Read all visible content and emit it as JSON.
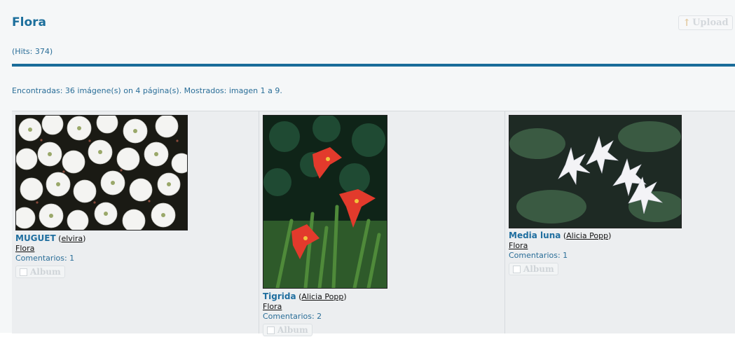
{
  "header": {
    "title": "Flora",
    "hits": "(Hits: 374)",
    "upload_label": "Upload"
  },
  "summary": "Encontradas: 36 imágene(s) on 4 página(s). Mostrados: imagen 1 a 9.",
  "images": [
    {
      "name": "MUGUET",
      "author": "elvira",
      "category": "Flora",
      "comments": "Comentarios: 1",
      "album_label": "Album",
      "subject": "white-flower-cluster"
    },
    {
      "name": "Tigrida",
      "author": "Alicia Popp",
      "category": "Flora",
      "comments": "Comentarios: 2",
      "album_label": "Album",
      "subject": "red-tigridia-flowers"
    },
    {
      "name": "Media luna",
      "author": "Alicia Popp",
      "category": "Flora",
      "comments": "Comentarios: 1",
      "album_label": "Album",
      "subject": "white-star-jasmine"
    }
  ],
  "colors": {
    "accent": "#1c6f9c",
    "rule": "#1a6c9a",
    "panel": "#eceef0"
  }
}
